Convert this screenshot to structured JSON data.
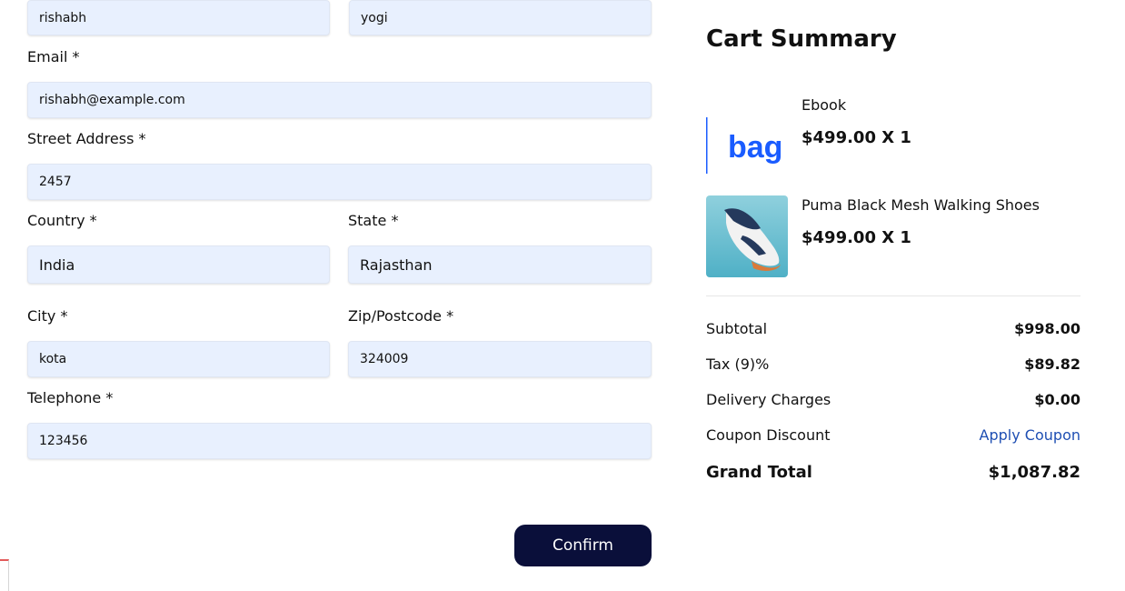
{
  "form": {
    "first_name": "rishabh",
    "last_name": "yogi",
    "email_label": "Email *",
    "email": "rishabh@example.com",
    "street_label": "Street Address *",
    "street": "2457",
    "country_label": "Country *",
    "country": "India",
    "state_label": "State *",
    "state": "Rajasthan",
    "city_label": "City *",
    "city": "kota",
    "zip_label": "Zip/Postcode *",
    "zip": "324009",
    "telephone_label": "Telephone *",
    "telephone": "123456",
    "confirm_label": "Confirm"
  },
  "summary": {
    "title": "Cart Summary",
    "items": [
      {
        "name": "Ebook",
        "price": "$499.00 X 1",
        "logo_text": "bag"
      },
      {
        "name": "Puma Black Mesh Walking Shoes",
        "price": "$499.00 X 1"
      }
    ],
    "subtotal_label": "Subtotal",
    "subtotal": "$998.00",
    "tax_label": "Tax (9)%",
    "tax": "$89.82",
    "delivery_label": "Delivery Charges",
    "delivery": "$0.00",
    "coupon_label": "Coupon Discount",
    "coupon_action": "Apply Coupon",
    "total_label": "Grand Total",
    "total": "$1,087.82"
  },
  "colors": {
    "field_bg": "#e8f0fe",
    "button_bg": "#0a0f3a",
    "link": "#1f4fb3",
    "brand_blue": "#1a5cff"
  }
}
